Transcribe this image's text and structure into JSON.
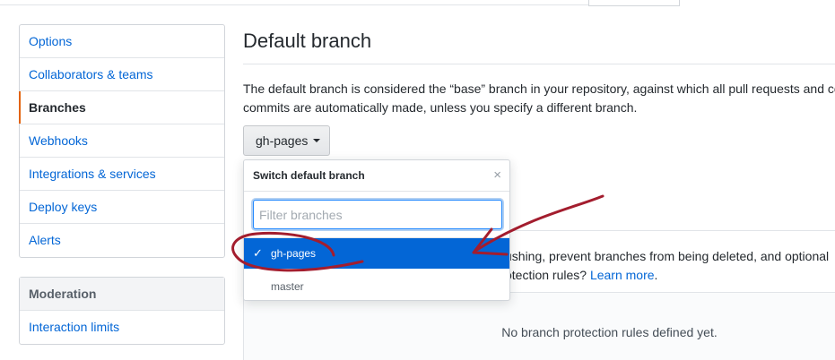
{
  "sidebar": {
    "items": [
      {
        "label": "Options"
      },
      {
        "label": "Collaborators & teams"
      },
      {
        "label": "Branches"
      },
      {
        "label": "Webhooks"
      },
      {
        "label": "Integrations & services"
      },
      {
        "label": "Deploy keys"
      },
      {
        "label": "Alerts"
      }
    ],
    "moderation": {
      "heading": "Moderation",
      "items": [
        {
          "label": "Interaction limits"
        }
      ]
    }
  },
  "main": {
    "title": "Default branch",
    "description_line1": "The default branch is considered the “base” branch in your repository, against which all pull requests and co",
    "description_line2": "commits are automatically made, unless you specify a different branch.",
    "branch_button_label": "gh-pages"
  },
  "dropdown": {
    "header": "Switch default branch",
    "close": "×",
    "filter_placeholder": "Filter branches",
    "filter_value": "",
    "branches": [
      {
        "name": "gh-pages",
        "selected": true,
        "check": "✓"
      },
      {
        "name": "master",
        "selected": false
      }
    ]
  },
  "protection": {
    "line1": "ushing, prevent branches from being deleted, and optional",
    "line2_prefix": "otection rules? ",
    "learn_more": "Learn more",
    "line2_suffix": ".",
    "empty_message": "No branch protection rules defined yet."
  },
  "icons": {
    "caret": "caret-down-icon",
    "close": "close-icon",
    "check": "check-icon"
  },
  "colors": {
    "link": "#0366d6",
    "selected_bg": "#0366d6",
    "selected_marker": "#e36209",
    "annotation": "#a31d2e"
  }
}
